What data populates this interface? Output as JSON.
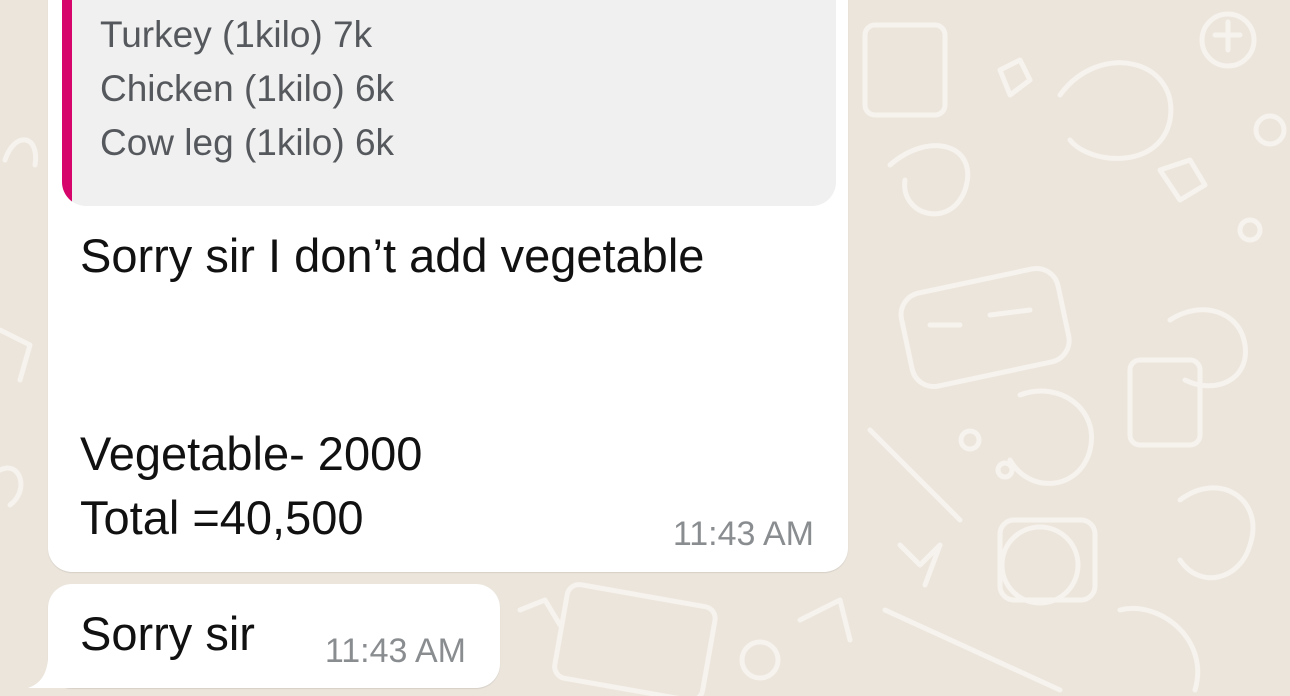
{
  "quoted_message": {
    "lines": [
      "Turkey (1kilo) 7k",
      "Chicken (1kilo) 6k",
      "Cow leg (1kilo) 6k"
    ]
  },
  "messages": [
    {
      "lines": [
        "Sorry sir I don’t add vegetable",
        "Vegetable- 2000",
        "Total =40,500"
      ],
      "time": "11:43 AM"
    },
    {
      "text": "Sorry sir",
      "time": "11:43 AM"
    }
  ],
  "colors": {
    "background": "#ece5dc",
    "bubble": "#ffffff",
    "quote_accent": "#d6056b",
    "quote_background": "#f0f0f0",
    "timestamp": "#8a8d90"
  }
}
